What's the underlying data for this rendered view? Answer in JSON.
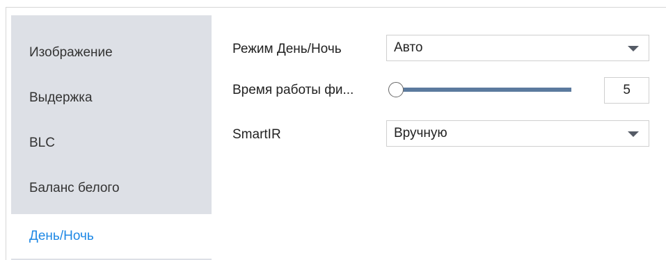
{
  "sidebar": {
    "items": [
      {
        "label": "Изображение"
      },
      {
        "label": "Выдержка"
      },
      {
        "label": "BLC"
      },
      {
        "label": "Баланс белого"
      },
      {
        "label": "День/Ночь",
        "active": true
      }
    ]
  },
  "form": {
    "day_night": {
      "label": "Режим День/Ночь",
      "value": "Авто"
    },
    "filter_time": {
      "label": "Время работы фи...",
      "value": "5",
      "slider_fraction": 0
    },
    "smartir": {
      "label": "SmartIR",
      "value": "Вручную"
    }
  },
  "colors": {
    "sidebar_bg": "#dde0e6",
    "active_text": "#1e88e5",
    "slider_track": "#5b7a9e"
  },
  "icons": {
    "dropdown": "caret-down-icon"
  }
}
